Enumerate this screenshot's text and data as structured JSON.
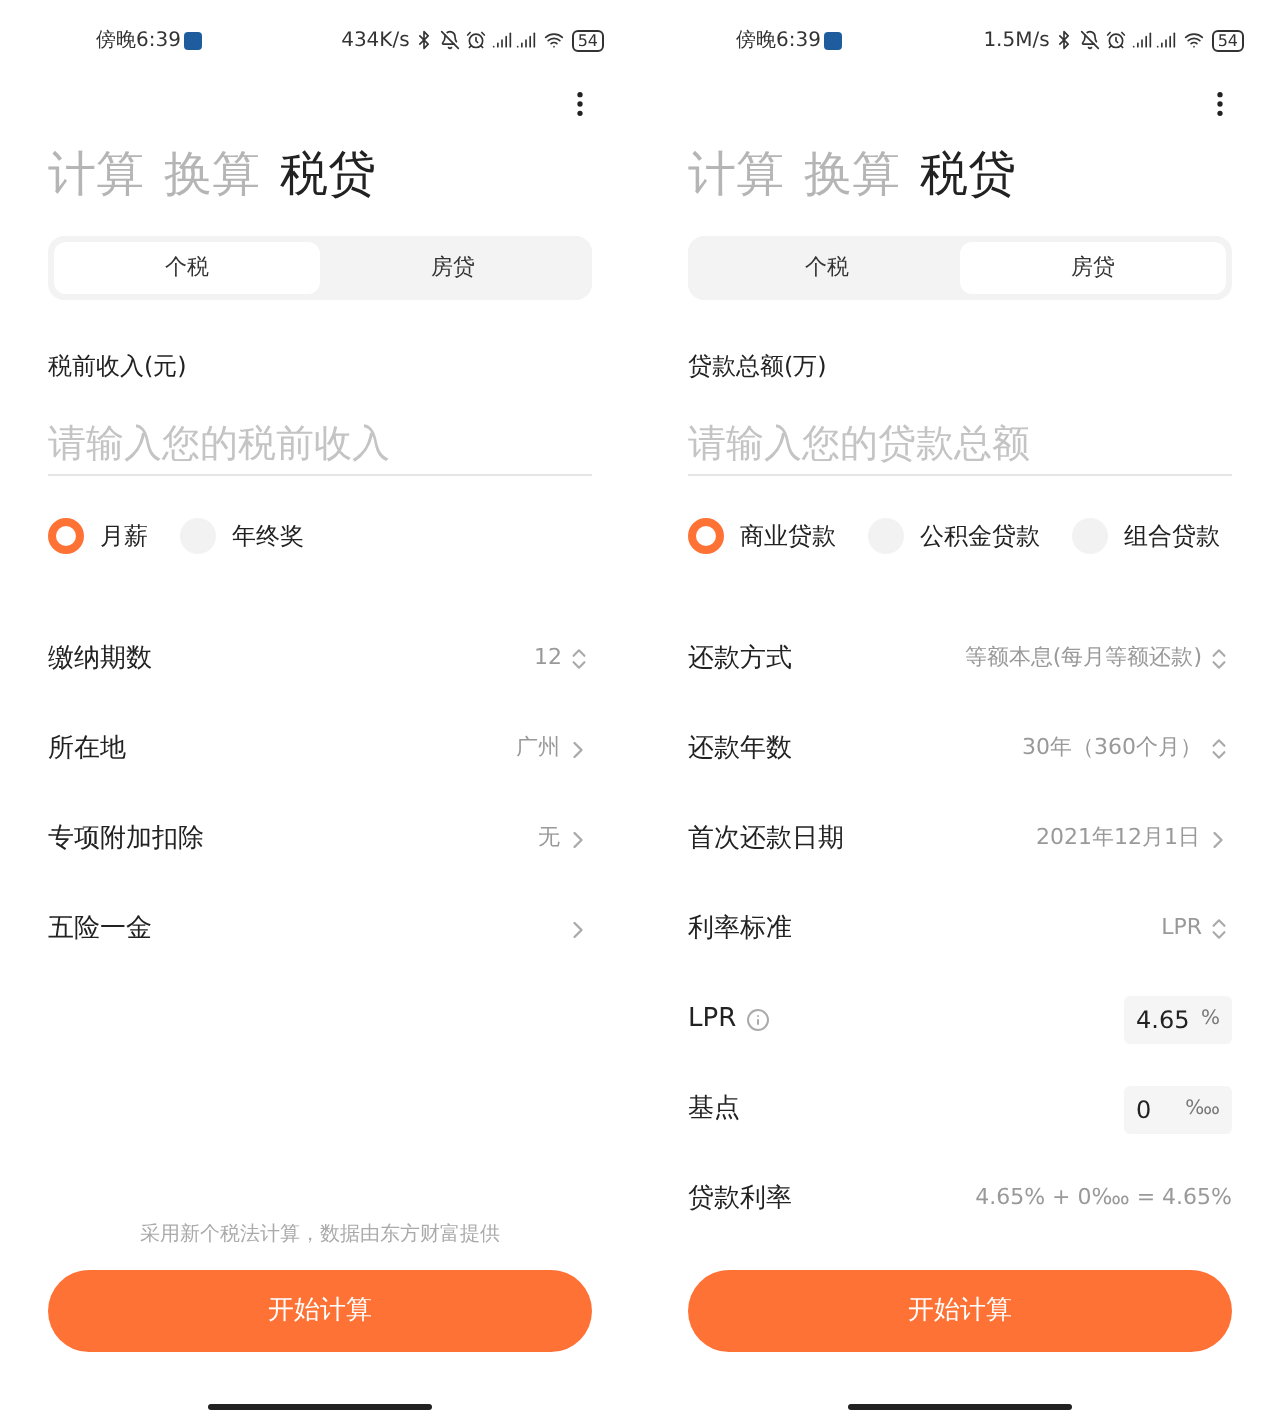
{
  "screens": [
    {
      "status_bar": {
        "time": "傍晚6:39",
        "speed": "434K/s",
        "battery": "54"
      },
      "title_tabs": [
        {
          "label": "计算",
          "selected": false
        },
        {
          "label": "换算",
          "selected": false
        },
        {
          "label": "税贷",
          "selected": true
        }
      ],
      "segments": [
        {
          "label": "个税",
          "selected": true
        },
        {
          "label": "房贷",
          "selected": false
        }
      ],
      "field": {
        "label": "税前收入(元)",
        "placeholder": "请输入您的税前收入"
      },
      "radios": [
        {
          "label": "月薪",
          "selected": true
        },
        {
          "label": "年终奖",
          "selected": false
        }
      ],
      "rows": [
        {
          "kind": "stepper",
          "label": "缴纳期数",
          "value": "12"
        },
        {
          "kind": "link",
          "label": "所在地",
          "value": "广州"
        },
        {
          "kind": "link",
          "label": "专项附加扣除",
          "value": "无"
        },
        {
          "kind": "link",
          "label": "五险一金"
        }
      ],
      "note": "采用新个税法计算，数据由东方财富提供",
      "button": "开始计算"
    },
    {
      "status_bar": {
        "time": "傍晚6:39",
        "speed": "1.5M/s",
        "battery": "54"
      },
      "title_tabs": [
        {
          "label": "计算",
          "selected": false
        },
        {
          "label": "换算",
          "selected": false
        },
        {
          "label": "税贷",
          "selected": true
        }
      ],
      "segments": [
        {
          "label": "个税",
          "selected": false
        },
        {
          "label": "房贷",
          "selected": true
        }
      ],
      "field": {
        "label": "贷款总额(万)",
        "placeholder": "请输入您的贷款总额"
      },
      "radios": [
        {
          "label": "商业贷款",
          "selected": true
        },
        {
          "label": "公积金贷款",
          "selected": false
        },
        {
          "label": "组合贷款",
          "selected": false
        }
      ],
      "rows": [
        {
          "kind": "stepper",
          "label": "还款方式",
          "value": "等额本息(每月等额还款)"
        },
        {
          "kind": "stepper",
          "label": "还款年数",
          "value": "30年（360个月）"
        },
        {
          "kind": "link",
          "label": "首次还款日期",
          "value": "2021年12月1日"
        },
        {
          "kind": "stepper",
          "label": "利率标准",
          "value": "LPR"
        },
        {
          "kind": "input",
          "label": "LPR",
          "info": true,
          "value": "4.65",
          "unit": "%"
        },
        {
          "kind": "input",
          "label": "基点",
          "value": "0",
          "unit": "‱"
        },
        {
          "kind": "text",
          "label": "贷款利率",
          "value": "4.65% + 0‱ = 4.65%"
        }
      ],
      "button": "开始计算"
    }
  ]
}
